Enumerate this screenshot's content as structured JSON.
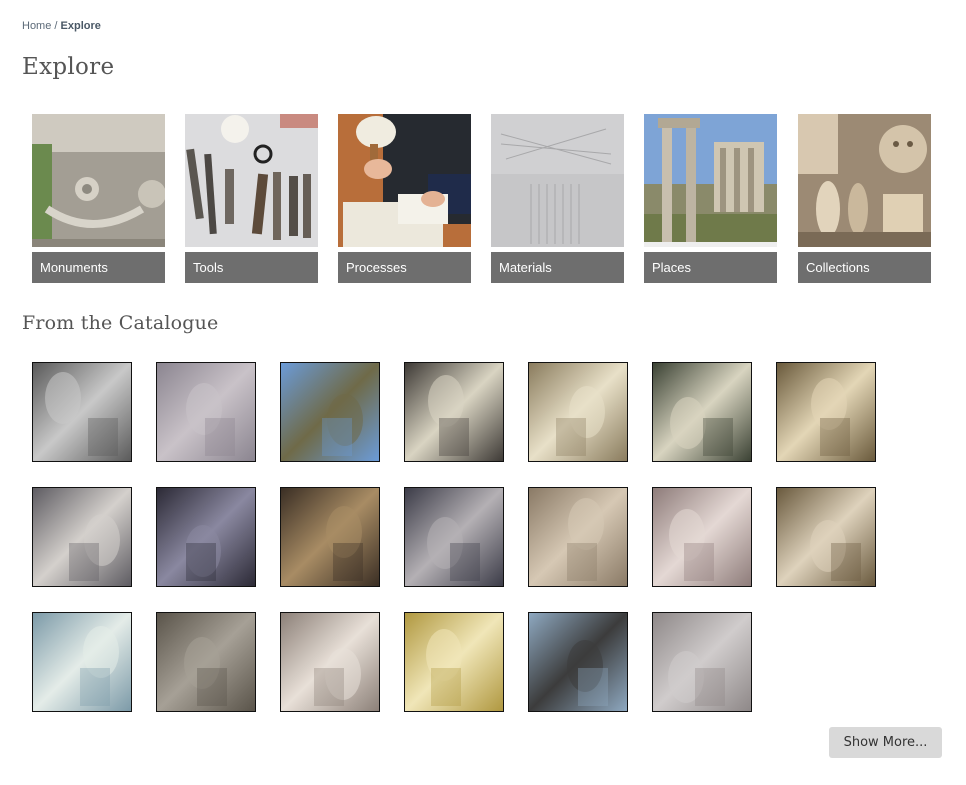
{
  "breadcrumb": {
    "home": "Home",
    "separator": " / ",
    "current": "Explore"
  },
  "page_title": "Explore",
  "categories": [
    {
      "label": "Monuments",
      "icon": "monument-relief-photo"
    },
    {
      "label": "Tools",
      "icon": "chisels-photo"
    },
    {
      "label": "Processes",
      "icon": "carving-photo"
    },
    {
      "label": "Materials",
      "icon": "marble-texture-photo"
    },
    {
      "label": "Places",
      "icon": "ruins-columns-photo"
    },
    {
      "label": "Collections",
      "icon": "plaster-casts-photo"
    }
  ],
  "catalogue_title": "From the Catalogue",
  "catalogue_items": [
    {
      "name": "relief-figures-photo",
      "colors": [
        "#5a5a5a",
        "#c8c8c8"
      ]
    },
    {
      "name": "relief-frieze-photo",
      "colors": [
        "#8b8590",
        "#c9c2c8"
      ]
    },
    {
      "name": "mountain-landscape-photo",
      "colors": [
        "#6b9bd8",
        "#6f6a48"
      ]
    },
    {
      "name": "marble-hand-photo",
      "colors": [
        "#3e3a36",
        "#d9d4c2"
      ]
    },
    {
      "name": "draped-statue-photo",
      "colors": [
        "#8a7c5e",
        "#e8e0c8"
      ]
    },
    {
      "name": "nude-statue-photo",
      "colors": [
        "#3b4234",
        "#d8d4c0"
      ]
    },
    {
      "name": "drapery-detail-photo",
      "colors": [
        "#6a5a3c",
        "#e3d6b6"
      ]
    },
    {
      "name": "marble-fragment-photo",
      "colors": [
        "#5e5c62",
        "#d4d0cc"
      ]
    },
    {
      "name": "dark-rock-photo",
      "colors": [
        "#2c2a36",
        "#8a88a0"
      ]
    },
    {
      "name": "chain-carving-photo",
      "colors": [
        "#3a2e24",
        "#a88c64"
      ]
    },
    {
      "name": "arch-relief-photo",
      "colors": [
        "#3c3c48",
        "#b4b0b4"
      ]
    },
    {
      "name": "carved-panel-photo",
      "colors": [
        "#8a7a66",
        "#d6c8b4"
      ]
    },
    {
      "name": "relief-boat-photo",
      "colors": [
        "#8e7c7a",
        "#e4d8d4"
      ]
    },
    {
      "name": "tapered-column-photo",
      "colors": [
        "#6a5a3e",
        "#ded2bc"
      ]
    },
    {
      "name": "stone-fragments-photo",
      "colors": [
        "#7c9aa8",
        "#e4ece8"
      ]
    },
    {
      "name": "wall-relief-photo",
      "colors": [
        "#5a544a",
        "#a6a096"
      ]
    },
    {
      "name": "drapery-block-photo",
      "colors": [
        "#8c8078",
        "#e8e0d8"
      ]
    },
    {
      "name": "veiled-head-photo",
      "colors": [
        "#b09840",
        "#f0e6b8"
      ]
    },
    {
      "name": "standing-columns-photo",
      "colors": [
        "#8ea8c0",
        "#3c3c3c"
      ]
    },
    {
      "name": "stone-door-panel-photo",
      "colors": [
        "#8e8888",
        "#d0cccc"
      ]
    }
  ],
  "show_more_label": "Show More..."
}
